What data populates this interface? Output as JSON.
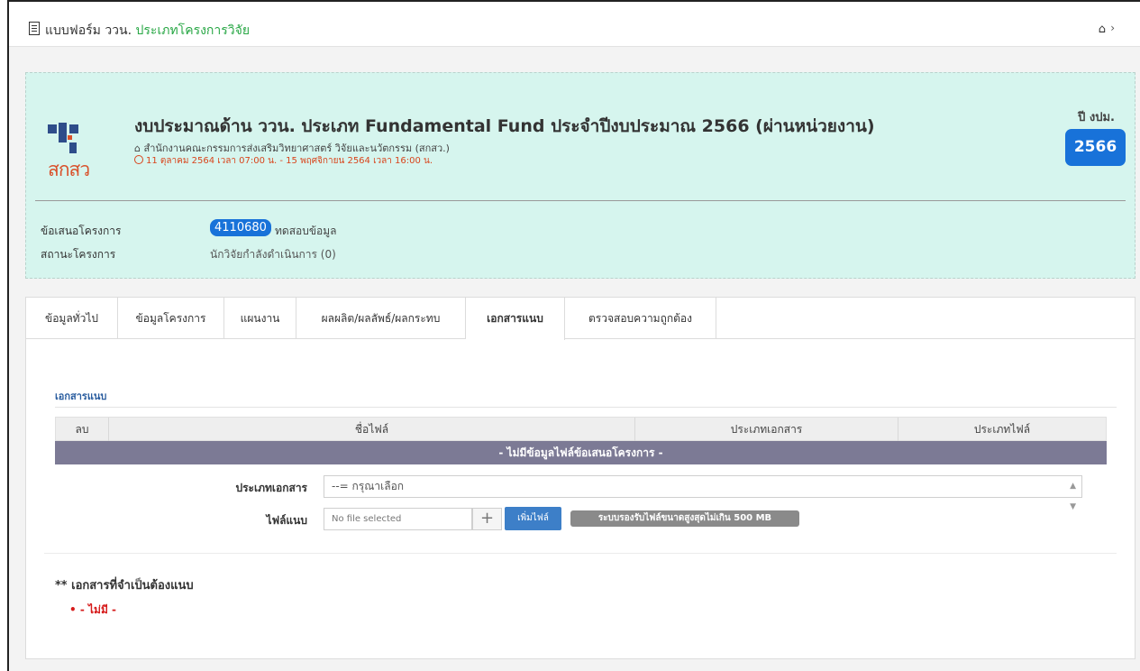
{
  "topbar": {
    "title_main": "แบบฟอร์ม ววน.",
    "title_sub": "ประเภทโครงการวิจัย",
    "home_icon": "home-icon",
    "chevron_icon": "chevron-right-icon"
  },
  "project": {
    "headline": "งบประมาณด้าน ววน. ประเภท Fundamental Fund ประจำปีงบประมาณ 2566 (ผ่านหน่วยงาน)",
    "agency": "สำนักงานคณะกรรมการส่งเสริมวิทยาศาสตร์ วิจัยและนวัตกรรม (สกสว.)",
    "period": "11 ตุลาคม 2564 เวลา 07:00 น. - 15 พฤศจิกายน 2564 เวลา 16:00 น.",
    "logo_text": "สกสว",
    "year_label": "ปี งปม.",
    "year_value": "2566",
    "proposal_label": "ข้อเสนอโครงการ",
    "proposal_id": "4110680",
    "proposal_note": "ทดสอบข้อมูล",
    "status_label": "สถานะโครงการ",
    "status_value": "นักวิจัยกำลังดำเนินการ (0)"
  },
  "tabs": [
    {
      "label": "ข้อมูลทั่วไป"
    },
    {
      "label": "ข้อมูลโครงการ"
    },
    {
      "label": "แผนงาน"
    },
    {
      "label": "ผลผลิต/ผลลัพธ์/ผลกระทบ"
    },
    {
      "label": "เอกสารแนบ"
    },
    {
      "label": "ตรวจสอบความถูกต้อง"
    }
  ],
  "attachments": {
    "section_title": "เอกสารแนบ",
    "columns": [
      "ลบ",
      "ชื่อไฟล์",
      "ประเภทเอกสาร",
      "ประเภทไฟล์"
    ],
    "empty_message": "- ไม่มีข้อมูลไฟล์ข้อเสนอโครงการ -",
    "doc_type_label": "ประเภทเอกสาร",
    "doc_type_value": "--= กรุณาเลือก",
    "file_label": "ไฟล์แนบ",
    "file_placeholder": "No file selected",
    "add_button": "เพิ่มไฟล์",
    "size_note": "ระบบรองรับไฟล์ขนาดสูงสุดไม่เกิน 500 MB"
  },
  "required": {
    "title": "** เอกสารที่จำเป็นต้องแนบ",
    "items": [
      "- ไม่มี -"
    ]
  },
  "colors": {
    "accent_blue": "#1872d9",
    "panel_bg": "#d6f5ee",
    "empty_row": "#7c7a95",
    "warning_text": "#d9441b",
    "required_text": "#d61b1b"
  }
}
